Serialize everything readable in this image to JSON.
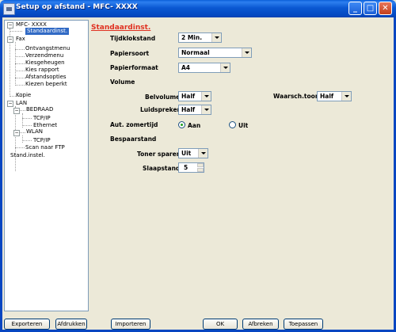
{
  "window": {
    "title": "Setup op afstand - MFC- XXXX",
    "minimize": "_",
    "maximize": "□",
    "close": "✕"
  },
  "tree": {
    "root": "MFC- XXXX",
    "selected": "Standaardinst.",
    "fax": "Fax",
    "fax_children": [
      "Ontvangstmenu",
      "Verzendmenu",
      "Kiesgeheugen",
      "Kies rapport",
      "Afstandsopties",
      "Kiezen beperkt"
    ],
    "kopie": "Kopie",
    "lan": "LAN",
    "bedraad": "BEDRAAD",
    "bedraad_children": [
      "TCP/IP",
      "Ethernet"
    ],
    "wlan": "WLAN",
    "wlan_children": [
      "TCP/IP"
    ],
    "scan_ftp": "Scan naar FTP",
    "stand_instel": "Stand.instel.",
    "expander": "−"
  },
  "panel": {
    "heading": "Standaardinst.",
    "tijdklokstand": {
      "label": "Tijdklokstand",
      "value": "2 Min."
    },
    "papiersoort": {
      "label": "Papiersoort",
      "value": "Normaal"
    },
    "papierformaat": {
      "label": "Papierformaat",
      "value": "A4"
    },
    "volume": {
      "label": "Volume",
      "belvolume": {
        "label": "Belvolume",
        "value": "Half"
      },
      "waarsch": {
        "label": "Waarsch.toon",
        "value": "Half"
      },
      "luidspreker": {
        "label": "Luidspreker",
        "value": "Half"
      }
    },
    "zomertijd": {
      "label": "Aut. zomertijd",
      "option_on": "Aan",
      "option_off": "Uit",
      "selected": "Aan"
    },
    "bespaarstand": {
      "label": "Bespaarstand",
      "toner": {
        "label": "Toner sparen",
        "value": "Uit"
      },
      "slaap": {
        "label": "Slaapstand",
        "value": "5"
      }
    }
  },
  "buttons": {
    "exporteren": "Exporteren",
    "afdrukken": "Afdrukken",
    "importeren": "Importeren",
    "ok": "OK",
    "afbreken": "Afbreken",
    "toepassen": "Toepassen"
  }
}
